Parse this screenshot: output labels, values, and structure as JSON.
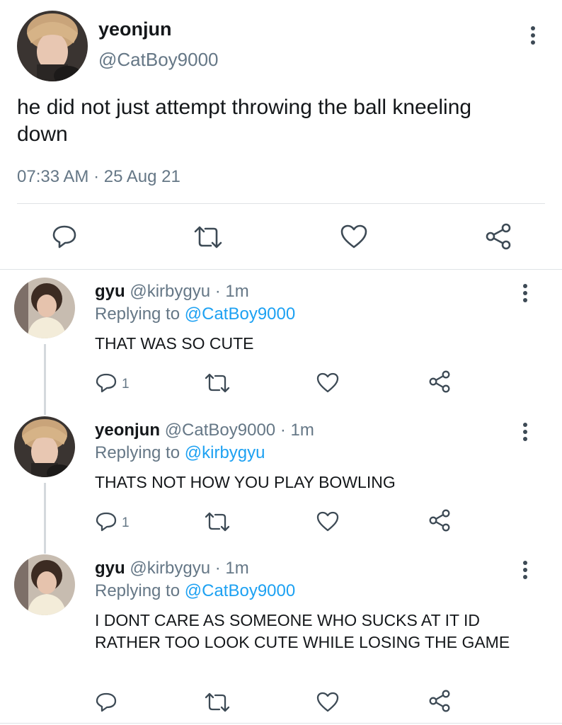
{
  "main_tweet": {
    "author_name": "yeonjun",
    "author_handle": "@CatBoy9000",
    "text": "he did not just attempt throwing the ball kneeling down",
    "timestamp": "07:33 AM · 25 Aug 21",
    "actions": [
      "reply-icon",
      "retweet-icon",
      "like-icon",
      "share-icon"
    ]
  },
  "replies": [
    {
      "name": "gyu",
      "handle": "@kirbygyu",
      "separator": "·",
      "time": "1m",
      "replying_prefix": "Replying to",
      "replying_to": "@CatBoy9000",
      "text": "THAT WAS SO CUTE",
      "reply_count": "1"
    },
    {
      "name": "yeonjun",
      "handle": "@CatBoy9000",
      "separator": "·",
      "time": "1m",
      "replying_prefix": "Replying to",
      "replying_to": "@kirbygyu",
      "text": "THATS NOT HOW YOU PLAY BOWLING",
      "reply_count": "1"
    },
    {
      "name": "gyu",
      "handle": "@kirbygyu",
      "separator": "·",
      "time": "1m",
      "replying_prefix": "Replying to",
      "replying_to": "@CatBoy9000",
      "text": "I DONT CARE AS SOMEONE WHO SUCKS AT IT ID RATHER TOO LOOK CUTE WHILE LOSING THE GAME",
      "reply_count": ""
    }
  ],
  "colors": {
    "text": "#14171a",
    "secondary": "#657786",
    "link": "#1da1f2",
    "divider": "#dfe3e6"
  }
}
